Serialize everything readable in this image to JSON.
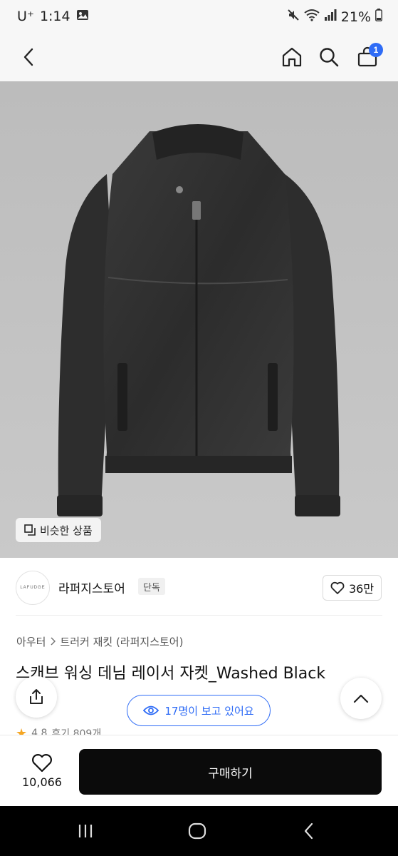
{
  "status_bar": {
    "carrier": "U⁺",
    "time": "1:14",
    "battery": "21%"
  },
  "header": {
    "cart_count": "1",
    "icons": [
      "back-icon",
      "home-icon",
      "search-icon",
      "cart-icon"
    ]
  },
  "product_image": {
    "similar_label": "비슷한 상품"
  },
  "store": {
    "logo_text": "LAFUDGE",
    "name": "라퍼지스토어",
    "tag": "단독",
    "likes": "36만"
  },
  "breadcrumb": {
    "items": [
      "아우터",
      "트러커 재킷 (라퍼지스토어)"
    ]
  },
  "product": {
    "title": "스캐브 워싱 데님 레이서 자켓_Washed Black",
    "rating": "4.8",
    "reviews": "후기 809개"
  },
  "floating": {
    "viewers": "17명이 보고 있어요"
  },
  "bottom_bar": {
    "wish_count": "10,066",
    "buy_label": "구매하기"
  },
  "colors": {
    "accent": "#2f6cf6",
    "buy_button": "#0b0b0b",
    "image_bg": "#c4c4c4"
  }
}
